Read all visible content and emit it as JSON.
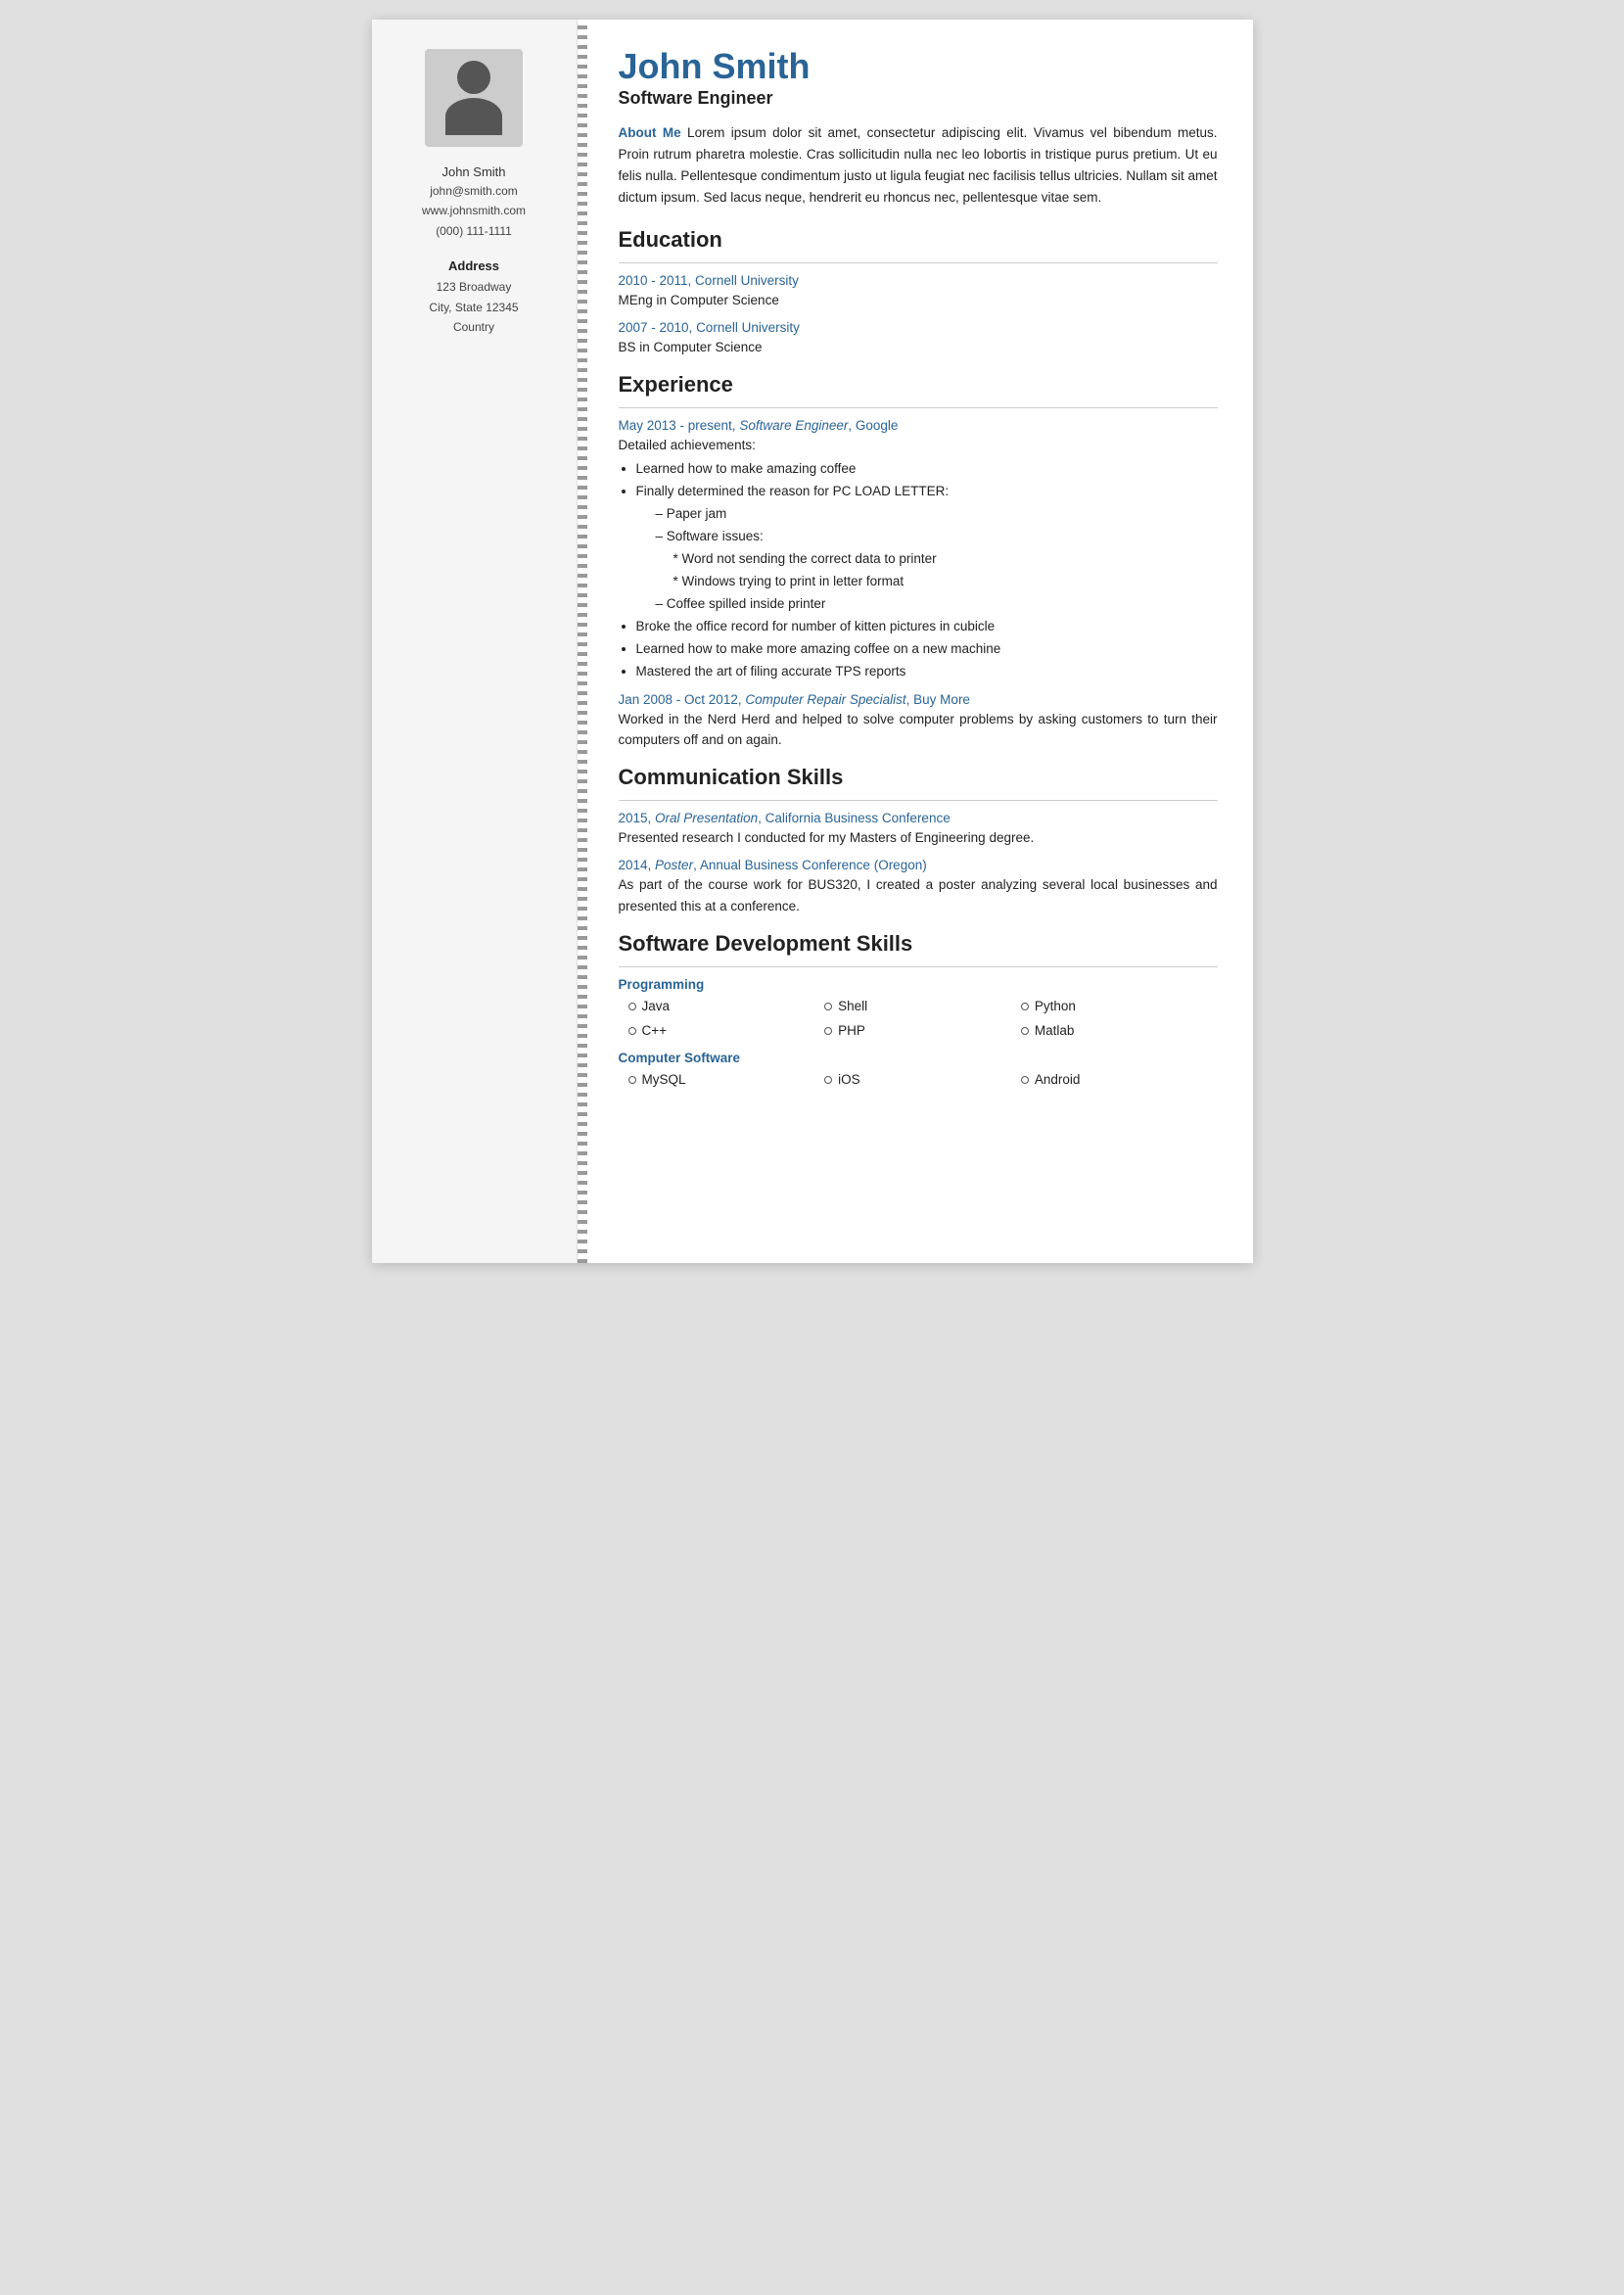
{
  "sidebar": {
    "name": "John Smith",
    "contact": {
      "email": "john@smith.com",
      "website": "www.johnsmith.com",
      "phone": "(000) 111-1111"
    },
    "address_label": "Address",
    "address": {
      "street": "123 Broadway",
      "city_state": "City, State 12345",
      "country": "Country"
    }
  },
  "main": {
    "name": "John Smith",
    "title": "Software Engineer",
    "about_me_label": "About Me",
    "about_me_text": " Lorem ipsum dolor sit amet, consectetur adipiscing elit. Vivamus vel bibendum metus. Proin rutrum pharetra molestie. Cras sollicitudin nulla nec leo lobortis in tristique purus pretium. Ut eu felis nulla. Pellentesque condimentum justo ut ligula feugiat nec facilisis tellus ultricies. Nullam sit amet dictum ipsum. Sed lacus neque, hendrerit eu rhoncus nec, pellentesque vitae sem.",
    "education_title": "Education",
    "education": [
      {
        "header": "2010 - 2011, Cornell University",
        "degree": "MEng in Computer Science"
      },
      {
        "header": "2007 - 2010, Cornell University",
        "degree": "BS in Computer Science"
      }
    ],
    "experience_title": "Experience",
    "experience": [
      {
        "header": "May 2013 - present, ",
        "role": "Software Engineer",
        "org": ", Google",
        "body": "Detailed achievements:",
        "bullets": [
          "Learned how to make amazing coffee",
          "Finally determined the reason for PC LOAD LETTER:"
        ],
        "sub_bullets": [
          "Paper jam",
          "Software issues:"
        ],
        "sub_sub_bullets": [
          "Word not sending the correct data to printer",
          "Windows trying to print in letter format"
        ],
        "sub_bullets2": [
          "Coffee spilled inside printer"
        ],
        "bullets2": [
          "Broke the office record for number of kitten pictures in cubicle",
          "Learned how to make more amazing coffee on a new machine",
          "Mastered the art of filing accurate TPS reports"
        ]
      },
      {
        "header": "Jan 2008 - Oct 2012, ",
        "role": "Computer Repair Specialist",
        "org": ", Buy More",
        "body": "Worked in the Nerd Herd and helped to solve computer problems by asking customers to turn their computers off and on again."
      }
    ],
    "communication_title": "Communication Skills",
    "communication": [
      {
        "header": "2015, ",
        "role": "Oral Presentation",
        "org": ", California Business Conference",
        "body": "Presented research I conducted for my Masters of Engineering degree."
      },
      {
        "header": "2014, ",
        "role": "Poster",
        "org": ", Annual Business Conference (Oregon)",
        "body": "As part of the course work for BUS320, I created a poster analyzing several local businesses and presented this at a conference."
      }
    ],
    "skills_title": "Software Development Skills",
    "skills": [
      {
        "category": "Programming",
        "items": [
          "Java",
          "Shell",
          "Python",
          "C++",
          "PHP",
          "Matlab"
        ]
      },
      {
        "category": "Computer Software",
        "items": [
          "MySQL",
          "iOS",
          "Android"
        ]
      }
    ]
  }
}
